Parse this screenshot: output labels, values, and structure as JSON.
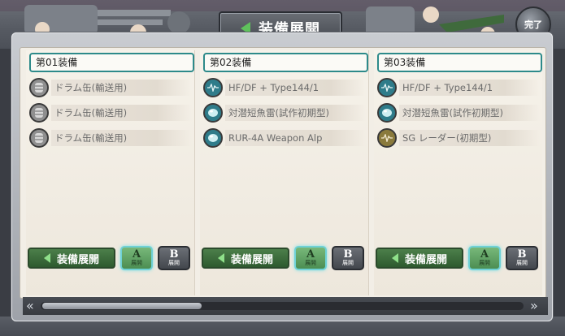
{
  "header": {
    "title": "装備展開",
    "done_label": "完了"
  },
  "columns": [
    {
      "title": "第01装備",
      "items": [
        {
          "name": "ドラム缶(輸送用)",
          "icon": "drum-icon"
        },
        {
          "name": "ドラム缶(輸送用)",
          "icon": "drum-icon"
        },
        {
          "name": "ドラム缶(輸送用)",
          "icon": "drum-icon"
        }
      ],
      "deploy_label": "装備展開",
      "a_label": "A",
      "a_sub": "展開",
      "b_label": "B",
      "b_sub": "展開"
    },
    {
      "title": "第02装備",
      "items": [
        {
          "name": "HF/DF + Type144/1",
          "icon": "sonar-icon"
        },
        {
          "name": "対潜短魚雷(試作初期型)",
          "icon": "depth-charge-icon"
        },
        {
          "name": "RUR-4A Weapon Alp",
          "icon": "depth-charge-icon"
        }
      ],
      "deploy_label": "装備展開",
      "a_label": "A",
      "a_sub": "展開",
      "b_label": "B",
      "b_sub": "展開"
    },
    {
      "title": "第03装備",
      "items": [
        {
          "name": "HF/DF + Type144/1",
          "icon": "sonar-icon"
        },
        {
          "name": "対潜短魚雷(試作初期型)",
          "icon": "depth-charge-icon"
        },
        {
          "name": "SG レーダー(初期型)",
          "icon": "radar-icon"
        }
      ],
      "deploy_label": "装備展開",
      "a_label": "A",
      "a_sub": "展開",
      "b_label": "B",
      "b_sub": "展開"
    }
  ],
  "colors": {
    "accent_teal": "#2d8a8a",
    "deploy_green": "#2e5a2f",
    "selected_a": "#6fd1d6"
  }
}
